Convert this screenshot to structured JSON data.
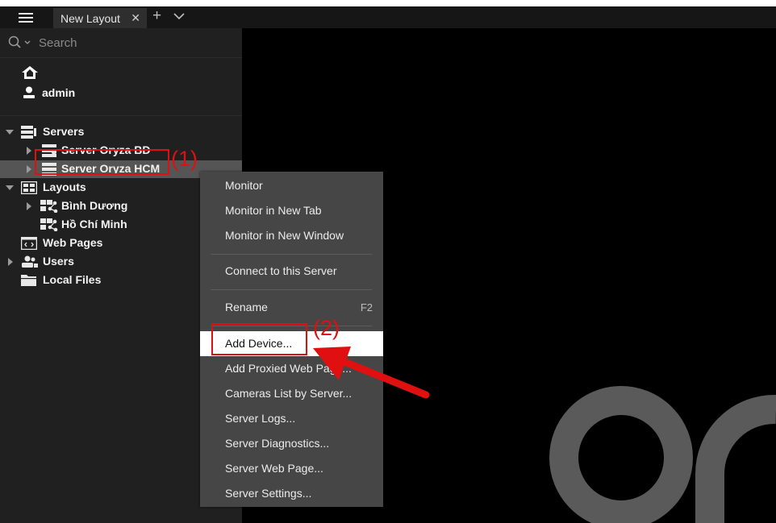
{
  "tabs": [
    {
      "label": "New Layout"
    }
  ],
  "search": {
    "placeholder": "Search"
  },
  "user": {
    "name": "admin"
  },
  "tree": {
    "servers": "Servers",
    "server_bd": "Server Oryza BD",
    "server_hcm": "Server Oryza HCM",
    "layouts": "Layouts",
    "layout_bd": "Bình Dương",
    "layout_hcm": "Hồ Chí Minh",
    "web_pages": "Web Pages",
    "users": "Users",
    "local_files": "Local Files"
  },
  "context_menu": {
    "monitor": "Monitor",
    "monitor_new_tab": "Monitor in New Tab",
    "monitor_new_window": "Monitor in New Window",
    "connect": "Connect to this Server",
    "rename": "Rename",
    "rename_shortcut": "F2",
    "add_device": "Add Device...",
    "add_proxied": "Add Proxied Web Page...",
    "cameras_list": "Cameras List by Server...",
    "server_logs": "Server Logs...",
    "server_diag": "Server Diagnostics...",
    "server_web": "Server Web Page...",
    "server_settings": "Server Settings..."
  },
  "annotations": {
    "step1": "(1)",
    "step2": "(2)"
  },
  "colors": {
    "annotation": "#e01010",
    "selection": "#555555",
    "menu_bg": "#464646",
    "logo": "#5a5a5a"
  }
}
